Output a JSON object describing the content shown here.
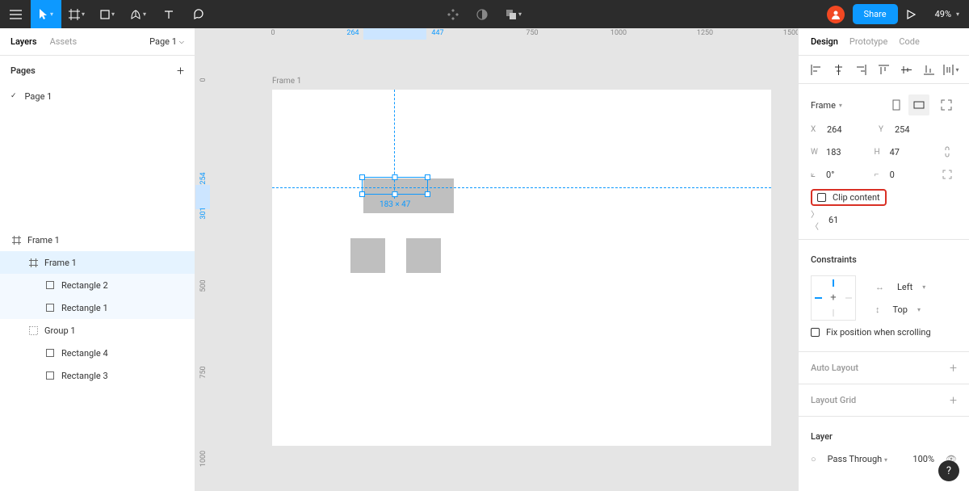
{
  "toolbar": {
    "share_label": "Share",
    "zoom": "49%"
  },
  "left": {
    "tabs": {
      "layers": "Layers",
      "assets": "Assets"
    },
    "page_switch": "Page 1",
    "pages_header": "Pages",
    "pages": [
      {
        "name": "Page 1"
      }
    ],
    "layers": [
      {
        "name": "Frame 1",
        "depth": 0,
        "icon": "frame",
        "sel": false
      },
      {
        "name": "Frame 1",
        "depth": 1,
        "icon": "frame",
        "sel": true
      },
      {
        "name": "Rectangle 2",
        "depth": 2,
        "icon": "rect",
        "sel": true,
        "light": true
      },
      {
        "name": "Rectangle 1",
        "depth": 2,
        "icon": "rect",
        "sel": true,
        "light": true
      },
      {
        "name": "Group 1",
        "depth": 1,
        "icon": "group",
        "sel": false
      },
      {
        "name": "Rectangle 4",
        "depth": 2,
        "icon": "rect",
        "sel": false
      },
      {
        "name": "Rectangle 3",
        "depth": 2,
        "icon": "rect",
        "sel": false
      }
    ]
  },
  "canvas": {
    "ruler_h": [
      "0",
      "264",
      "447",
      "750",
      "1000",
      "1250",
      "1500"
    ],
    "ruler_v": [
      "0",
      "254",
      "301",
      "500",
      "750",
      "1000"
    ],
    "frame_label": "Frame 1",
    "selection_size": "183 × 47"
  },
  "right": {
    "tabs": {
      "design": "Design",
      "prototype": "Prototype",
      "code": "Code"
    },
    "frame_type": "Frame",
    "x_label": "X",
    "x": "264",
    "y_label": "Y",
    "y": "254",
    "w_label": "W",
    "w": "183",
    "h_label": "H",
    "h": "47",
    "rot_label": "⟀",
    "rot": "0°",
    "rad_label": "⌐",
    "rad": "0",
    "clip": "Clip content",
    "gap": "61",
    "constraints_title": "Constraints",
    "constraint_h": "Left",
    "constraint_v": "Top",
    "fix_position": "Fix position when scrolling",
    "auto_layout": "Auto Layout",
    "layout_grid": "Layout Grid",
    "layer_section": "Layer",
    "blend": "Pass Through",
    "opacity": "100%"
  }
}
